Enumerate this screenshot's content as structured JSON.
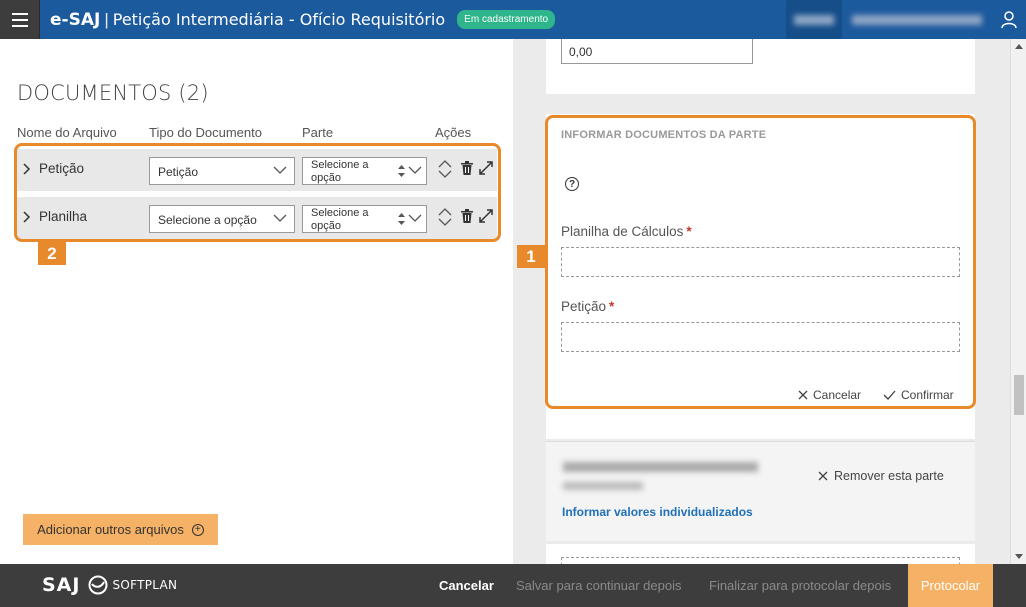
{
  "header": {
    "brand": "e-SAJ",
    "separator": "|",
    "title": "Petição Intermediária - Ofício Requisitório",
    "status": "Em cadastramento"
  },
  "documents": {
    "title": "DOCUMENTOS (2)",
    "columns": {
      "name": "Nome do Arquivo",
      "type": "Tipo do Documento",
      "party": "Parte",
      "actions": "Ações"
    },
    "rows": [
      {
        "name": "Petição",
        "type": "Petição",
        "party": "Selecione a opção"
      },
      {
        "name": "Planilha",
        "type": "Selecione a opção",
        "party": "Selecione a opção"
      }
    ],
    "add_button": "Adicionar outros arquivos"
  },
  "annotations": {
    "badge_1": "1",
    "badge_2": "2",
    "color": "#e8892b"
  },
  "right": {
    "value_input": "0,00",
    "card_heading": "INFORMAR DOCUMENTOS DA PARTE",
    "help": "?",
    "field_1_label": "Planilha de Cálculos",
    "field_2_label": "Petição",
    "required": "*",
    "cancel": "Cancelar",
    "confirm": "Confirmar",
    "remove_party": "Remover esta parte",
    "info_link": "Informar valores individualizados"
  },
  "footer": {
    "logo_saj": "SAJ",
    "logo_softplan": "SOFTPLAN",
    "cancel": "Cancelar",
    "save_later": "Salvar para continuar depois",
    "finalize_later": "Finalizar para protocolar depois",
    "protocol": "Protocolar"
  },
  "colors": {
    "header_blue": "#1c5a9e",
    "accent_orange": "#f5b165",
    "badge_green": "#2fb58c",
    "link_blue": "#1f70b8"
  }
}
